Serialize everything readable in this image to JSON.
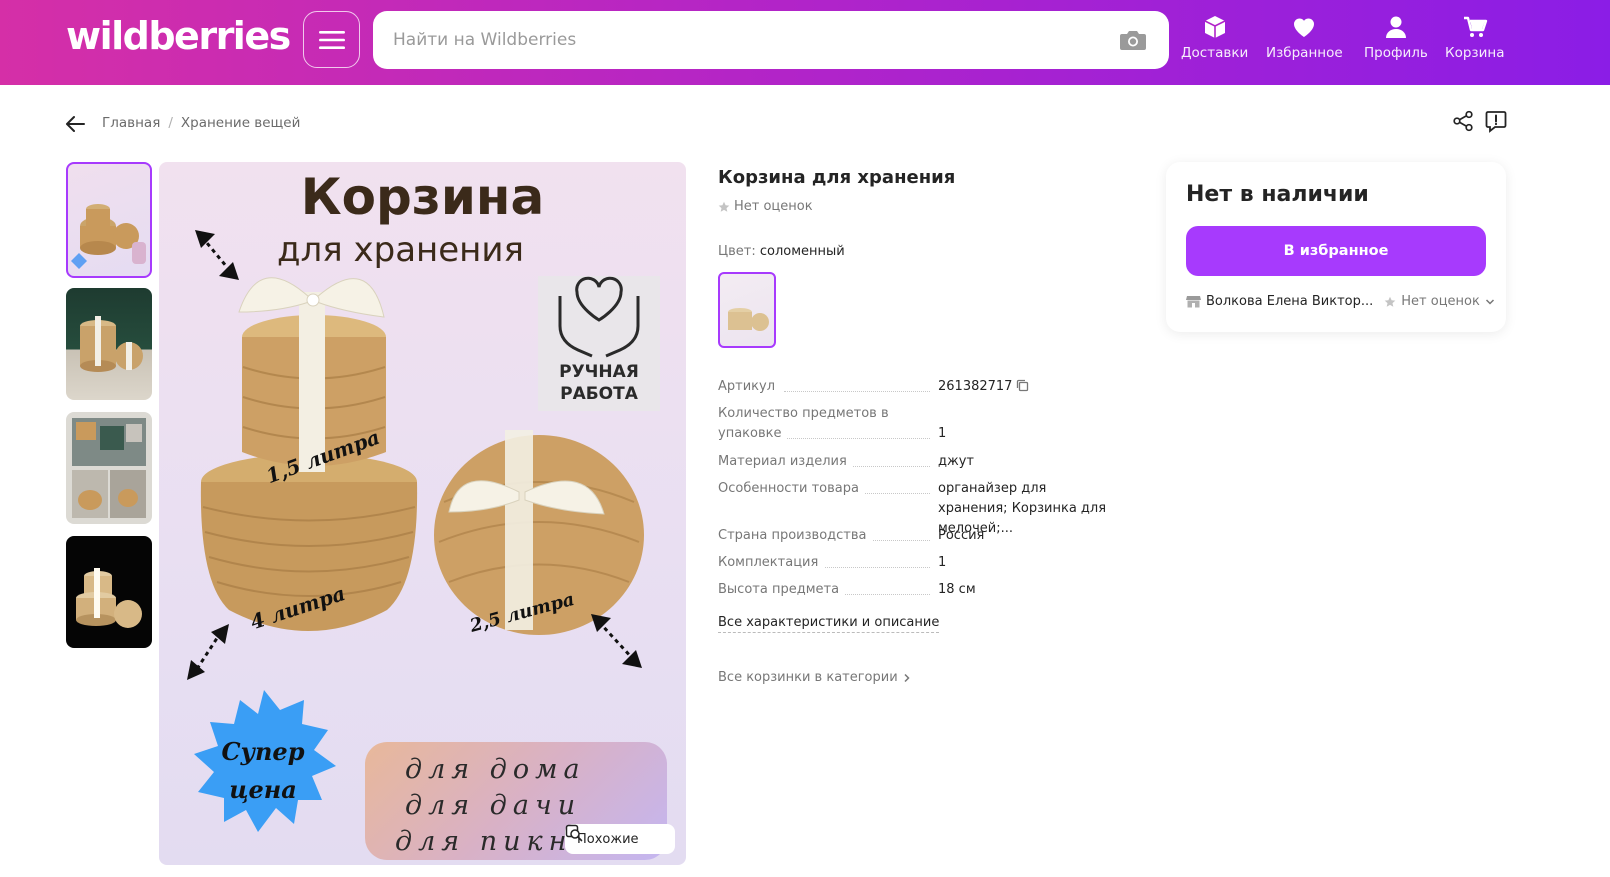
{
  "header": {
    "logo": "wildberries",
    "search_placeholder": "Найти на Wildberries",
    "nav": [
      {
        "label": "Доставки",
        "icon": "box-icon"
      },
      {
        "label": "Избранное",
        "icon": "heart-icon"
      },
      {
        "label": "Профиль",
        "icon": "user-icon"
      },
      {
        "label": "Корзина",
        "icon": "cart-icon"
      }
    ]
  },
  "breadcrumb": {
    "items": [
      "Главная",
      "Хранение вещей"
    ],
    "separator": "/"
  },
  "image": {
    "title": "Корзина",
    "subtitle": "для хранения",
    "handmade_label": "РУЧНАЯ\nРАБОТА",
    "label_small": "1,5 литра",
    "label_large": "4 литра",
    "label_medium": "2,5 литра",
    "badge": "Супер\nцена",
    "uses": [
      "для дома",
      "для дачи",
      "для пикника"
    ],
    "similar_label": "Похожие"
  },
  "product": {
    "title": "Корзина для хранения",
    "rating": "Нет оценок",
    "color_label": "Цвет:",
    "color_value": "соломенный",
    "specs": [
      {
        "label": "Артикул",
        "value": "261382717",
        "copy": true
      },
      {
        "label": "Количество предметов в упаковке",
        "value": "1"
      },
      {
        "label": "Материал изделия",
        "value": "джут"
      },
      {
        "label": "Особенности товара",
        "value": "органайзер для хранения; Корзинка для мелочей;..."
      },
      {
        "label": "Страна производства",
        "value": "Россия"
      },
      {
        "label": "Комплектация",
        "value": "1"
      },
      {
        "label": "Высота предмета",
        "value": "18 см"
      }
    ],
    "all_specs_link": "Все характеристики и описание",
    "category_link": "Все корзинки в категории"
  },
  "buy_card": {
    "status": "Нет в наличии",
    "favorite_button": "В избранное",
    "seller": "Волкова Елена Виктор...",
    "seller_rating": "Нет оценок"
  },
  "colors": {
    "accent": "#a73afd",
    "header_start": "#d52fa7",
    "header_end": "#8b1de6"
  }
}
